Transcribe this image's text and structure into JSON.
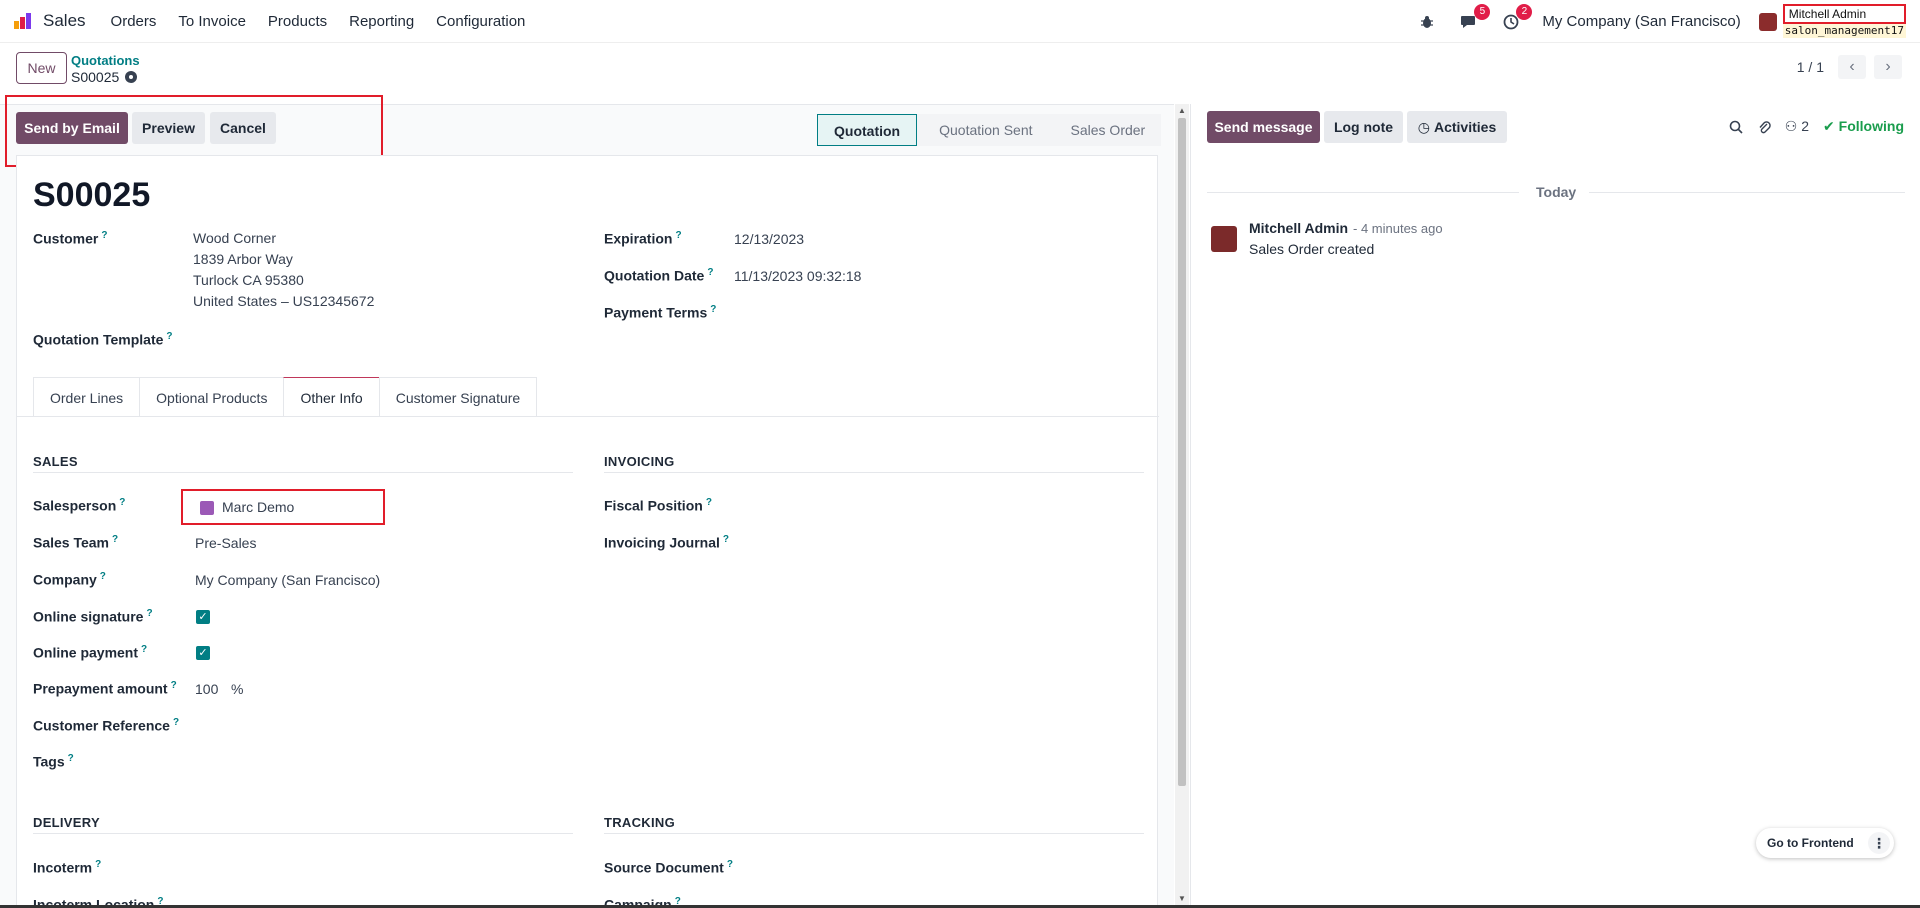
{
  "navbar": {
    "app_name": "Sales",
    "menu": [
      "Orders",
      "To Invoice",
      "Products",
      "Reporting",
      "Configuration"
    ],
    "messages_badge": "5",
    "activities_badge": "2",
    "company": "My Company (San Francisco)",
    "user_name": "Mitchell Admin",
    "database": "salon_management17",
    "logo_colors": [
      "#f59e0b",
      "#e11d48",
      "#7c3aed"
    ]
  },
  "control_panel": {
    "new_label": "New",
    "breadcrumb": "Quotations",
    "record_name": "S00025",
    "pager": "1 / 1"
  },
  "status_bar": {
    "buttons": [
      "Send by Email",
      "Preview",
      "Cancel"
    ],
    "stages": [
      "Quotation",
      "Quotation Sent",
      "Sales Order"
    ],
    "active_stage": "Quotation"
  },
  "form": {
    "title": "S00025",
    "customer_label": "Customer",
    "customer_lines": [
      "Wood Corner",
      "1839 Arbor Way",
      "Turlock CA 95380",
      "United States – US12345672"
    ],
    "quotation_template_label": "Quotation Template",
    "expiration_label": "Expiration",
    "expiration_value": "12/13/2023",
    "quotation_date_label": "Quotation Date",
    "quotation_date_value": "11/13/2023 09:32:18",
    "payment_terms_label": "Payment Terms",
    "tabs": [
      "Order Lines",
      "Optional Products",
      "Other Info",
      "Customer Signature"
    ],
    "active_tab": "Other Info",
    "sales": {
      "title": "SALES",
      "salesperson_label": "Salesperson",
      "salesperson_value": "Marc Demo",
      "sales_team_label": "Sales Team",
      "sales_team_value": "Pre-Sales",
      "company_label": "Company",
      "company_value": "My Company (San Francisco)",
      "online_signature_label": "Online signature",
      "online_signature_checked": true,
      "online_payment_label": "Online payment",
      "online_payment_checked": true,
      "prepayment_label": "Prepayment amount",
      "prepayment_value": "100",
      "prepayment_unit": "%",
      "customer_reference_label": "Customer Reference",
      "tags_label": "Tags"
    },
    "invoicing": {
      "title": "INVOICING",
      "fiscal_position_label": "Fiscal Position",
      "invoicing_journal_label": "Invoicing Journal"
    },
    "delivery": {
      "title": "DELIVERY",
      "incoterm_label": "Incoterm",
      "incoterm_location_label": "Incoterm Location"
    },
    "tracking": {
      "title": "TRACKING",
      "source_document_label": "Source Document",
      "campaign_label": "Campaign"
    }
  },
  "chatter": {
    "send_message": "Send message",
    "log_note": "Log note",
    "activities": "Activities",
    "followers_count": "2",
    "following": "Following",
    "date_separator": "Today",
    "message": {
      "author": "Mitchell Admin",
      "time": "- 4 minutes ago",
      "body": "Sales Order created"
    }
  },
  "frontend_button": "Go to Frontend",
  "colors": {
    "primary": "#714b67",
    "accent": "#017e84",
    "highlight": "#e11d2a",
    "following": "#1a9d4d"
  }
}
